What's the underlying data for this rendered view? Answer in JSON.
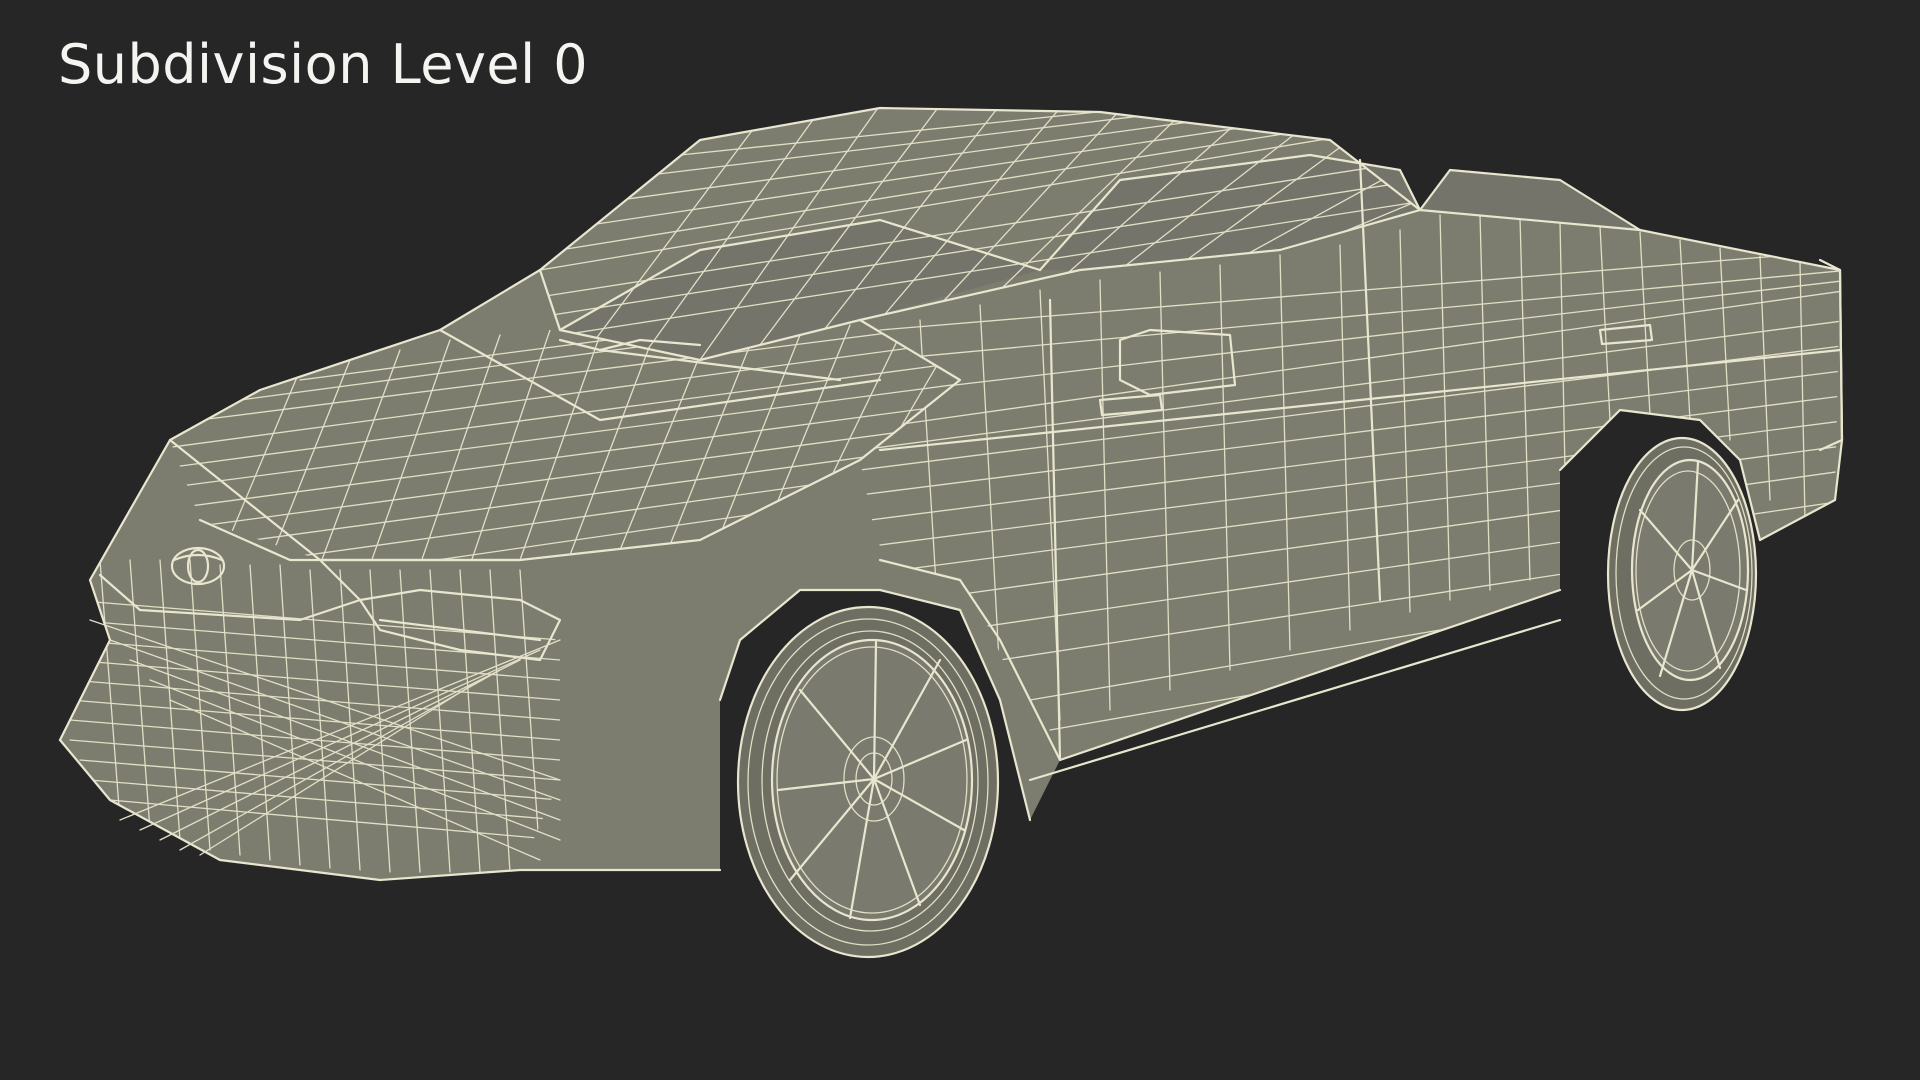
{
  "viewport": {
    "caption": "Subdivision Level 0"
  },
  "scene": {
    "subject": "car-wireframe",
    "background_color": "#262626",
    "mesh_fill_color": "#7d7d6f",
    "wire_color": "#e9e6cf"
  }
}
